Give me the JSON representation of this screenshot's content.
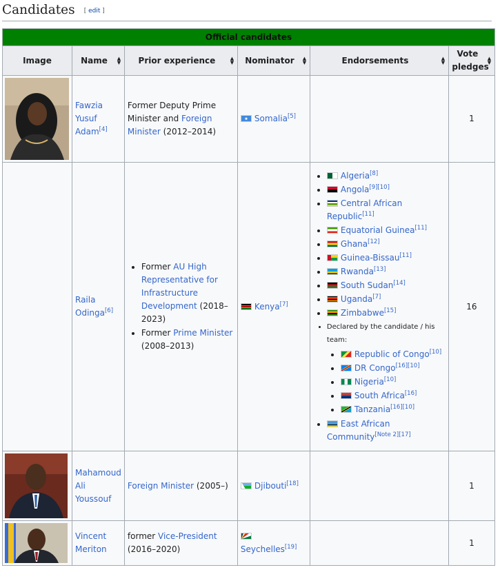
{
  "section": {
    "title": "Candidates",
    "edit_open": "[ ",
    "edit_label": "edit",
    "edit_close": " ]"
  },
  "table": {
    "caption": "Official candidates",
    "headers": [
      "Image",
      "Name",
      "Prior experience",
      "Nominator",
      "Endorsements",
      "Vote pledges"
    ]
  },
  "rows": [
    {
      "name": "Fawzia Yusuf Adam",
      "name_lines": [
        "Fawzia",
        "Yusuf",
        "Adam"
      ],
      "name_ref": "[4]",
      "experience": {
        "t1": "Former Deputy Prime Minister and ",
        "link": "Foreign Minister",
        "t2": " (2012–2014)"
      },
      "nominator": "Somalia",
      "nominator_ref": "[5]",
      "pledges": "1"
    },
    {
      "name": "Raila Odinga",
      "name_lines": [
        "Raila",
        "Odinga"
      ],
      "name_ref": "[6]",
      "experience": {
        "items": [
          {
            "prefix": "Former ",
            "link": "AU High Representative for Infrastructure Development",
            "suffix": " (2018–2023)"
          },
          {
            "prefix": "Former ",
            "link": "Prime Minister",
            "suffix": " (2008–2013)"
          }
        ]
      },
      "nominator": "Kenya",
      "nominator_ref": "[7]",
      "endorsements": [
        {
          "name": "Algeria",
          "ref": "[8]"
        },
        {
          "name": "Angola",
          "ref": "[9][10]"
        },
        {
          "name": "Central African Republic",
          "ref": "[11]"
        },
        {
          "name": "Equatorial Guinea",
          "ref": "[11]"
        },
        {
          "name": "Ghana",
          "ref": "[12]"
        },
        {
          "name": "Guinea-Bissau",
          "ref": "[11]"
        },
        {
          "name": "Rwanda",
          "ref": "[13]"
        },
        {
          "name": "South Sudan",
          "ref": "[14]"
        },
        {
          "name": "Uganda",
          "ref": "[7]"
        },
        {
          "name": "Zimbabwe",
          "ref": "[15]"
        }
      ],
      "declared_label": "Declared by the candidate / his team:",
      "declared": [
        {
          "name": "Republic of Congo",
          "ref": "[10]"
        },
        {
          "name": "DR Congo",
          "ref": "[16][10]"
        },
        {
          "name": "Nigeria",
          "ref": "[10]"
        },
        {
          "name": "South Africa",
          "ref": "[16]"
        },
        {
          "name": "Tanzania",
          "ref": "[16][10]"
        }
      ],
      "community": {
        "name": "East African Community",
        "ref": "[Note 2][17]"
      },
      "pledges": "16"
    },
    {
      "name": "Mahamoud Ali Youssouf",
      "name_lines": [
        "Mahamoud",
        "Ali",
        "Youssouf"
      ],
      "name_ref": "",
      "experience": {
        "link": "Foreign Minister",
        "t2": " (2005–)"
      },
      "nominator": "Djibouti",
      "nominator_ref": "[18]",
      "pledges": "1"
    },
    {
      "name": "Vincent Meriton",
      "name_lines": [
        "Vincent",
        "Meriton"
      ],
      "name_ref": "",
      "experience": {
        "t1": "former ",
        "link": "Vice-President",
        "t2": " (2016–2020)"
      },
      "nominator": "Seychelles",
      "nominator_ref": "[19]",
      "pledges": "1"
    }
  ],
  "colors": {
    "caption_bg": "#008000",
    "link": "#3366cc",
    "header_bg": "#eaecf0",
    "border": "#a2a9b1"
  }
}
